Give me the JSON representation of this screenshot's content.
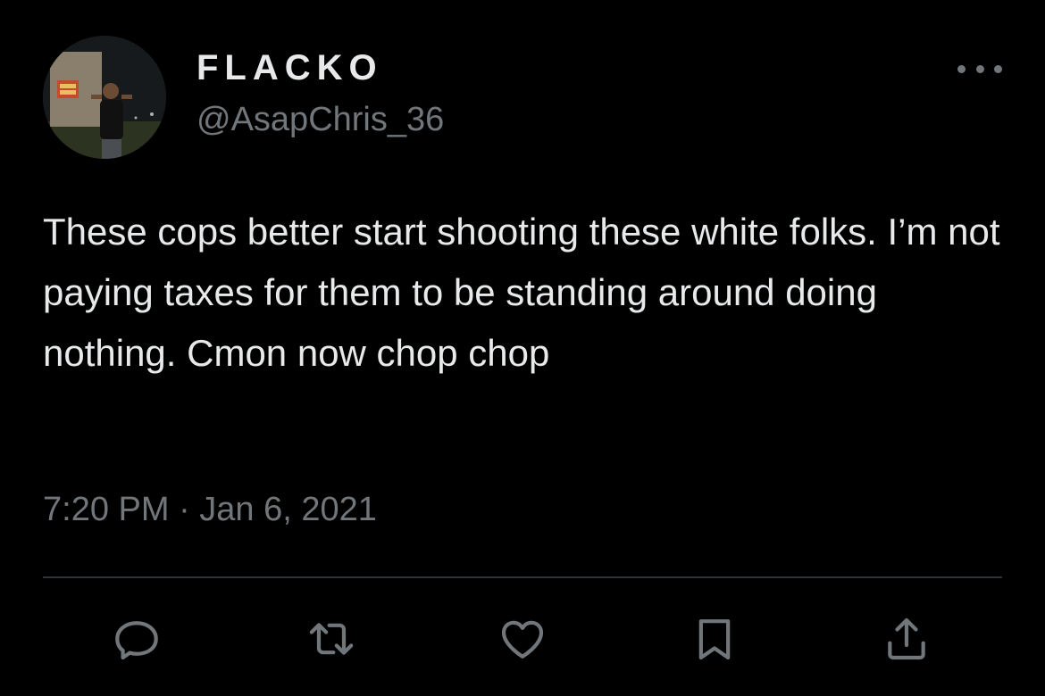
{
  "tweet": {
    "display_name": "FLACKO",
    "handle": "@AsapChris_36",
    "text": "These cops better start shooting these white folks. I’m not paying taxes for them to be standing around doing nothing. Cmon now chop chop",
    "timestamp": "7:20 PM · Jan 6, 2021"
  },
  "actions": [
    {
      "name": "reply",
      "icon": "reply-icon"
    },
    {
      "name": "retweet",
      "icon": "retweet-icon"
    },
    {
      "name": "like",
      "icon": "heart-icon"
    },
    {
      "name": "bookmark",
      "icon": "bookmark-icon"
    },
    {
      "name": "share",
      "icon": "share-icon"
    }
  ],
  "colors": {
    "background": "#000000",
    "primary_text": "#e7e9ea",
    "secondary_text": "#71767b",
    "divider": "#2f3336"
  }
}
